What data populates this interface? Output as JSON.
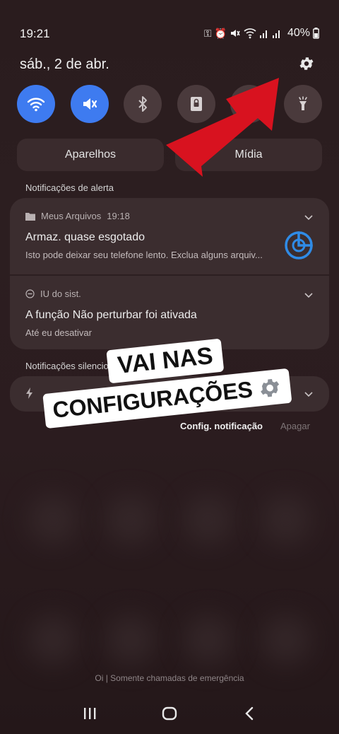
{
  "status_bar": {
    "time": "19:21",
    "battery": "40%",
    "icons": [
      "key-icon",
      "alarm-icon",
      "mute-icon",
      "wifi-icon",
      "signal-icon",
      "signal-icon",
      "battery-icon"
    ]
  },
  "header": {
    "date": "sáb., 2 de abr."
  },
  "quick_tiles": [
    {
      "name": "wifi",
      "active": true
    },
    {
      "name": "mute",
      "active": true
    },
    {
      "name": "bluetooth",
      "active": false
    },
    {
      "name": "screen-lock",
      "active": false
    },
    {
      "name": "hidden",
      "active": false
    },
    {
      "name": "flashlight",
      "active": false
    }
  ],
  "media": {
    "devices_label": "Aparelhos",
    "media_label": "Mídia"
  },
  "alert_section": {
    "label": "Notificações de alerta"
  },
  "notifications": [
    {
      "app": "Meus Arquivos",
      "time": "19:18",
      "title": "Armaz. quase esgotado",
      "body": "Isto pode deixar seu telefone lento. Exclua alguns arquiv..."
    },
    {
      "app": "IU do sist.",
      "title": "A função Não perturbar foi ativada",
      "body": "Até eu desativar"
    }
  ],
  "silent_section": {
    "label": "Notificações silencio"
  },
  "actions": {
    "settings_label": "Config. notificação",
    "clear_label": "Apagar"
  },
  "overlay": {
    "line1": "VAI NAS",
    "line2": "CONFIGURAÇÕES"
  },
  "footer": {
    "emergency": "Oi | Somente chamadas de emergência"
  },
  "colors": {
    "accent": "#3e7bf0",
    "arrow": "#d8121f",
    "background": "#2b1c1f"
  }
}
